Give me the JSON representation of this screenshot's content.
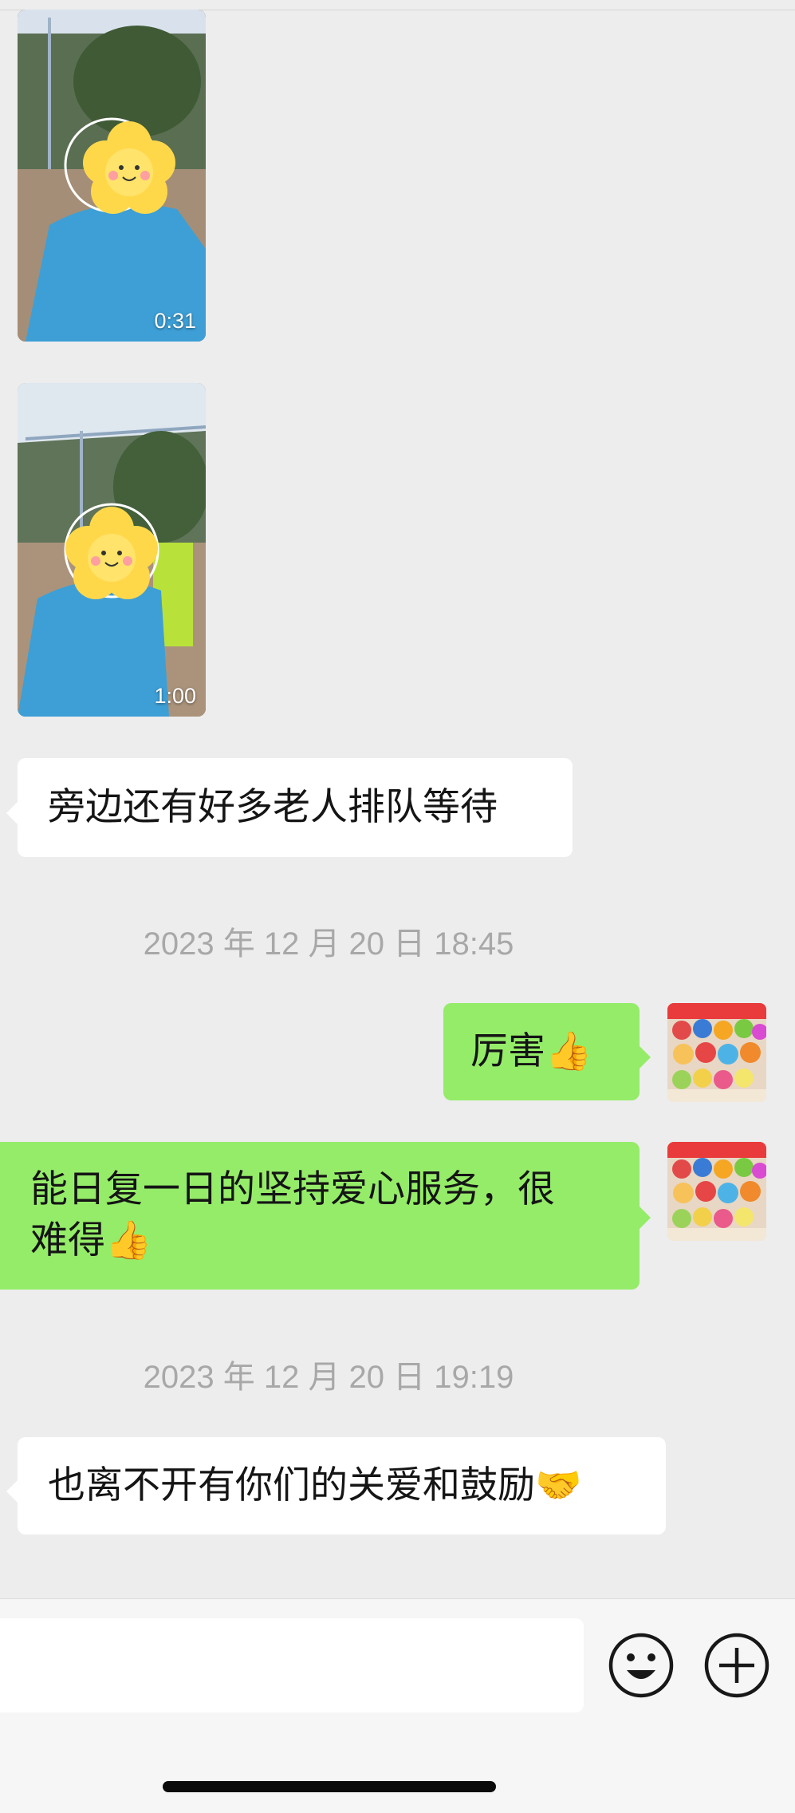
{
  "messages": {
    "video1": {
      "duration": "0:31"
    },
    "video2": {
      "duration": "1:00"
    },
    "incoming1": {
      "text": "旁边还有好多老人排队等待"
    },
    "timestamp1": {
      "text": "2023 年 12 月 20 日 18:45"
    },
    "outgoing1": {
      "text": "厉害",
      "emoji": "👍"
    },
    "outgoing2": {
      "line1": "能日复一日的坚持爱心服务，很",
      "line2": "难得",
      "emoji": "👍"
    },
    "timestamp2": {
      "text": "2023 年 12 月 20 日 19:19"
    },
    "incoming2": {
      "text": "也离不开有你们的关爱和鼓励",
      "emoji": "🤝"
    }
  },
  "input_bar": {
    "input_value": "",
    "emoji_icon": "smiley-face-icon",
    "more_icon": "plus-circle-icon"
  },
  "colors": {
    "background": "#ededed",
    "outgoing_bubble": "#95ec69",
    "incoming_bubble": "#ffffff",
    "timestamp_text": "#a8a8a8"
  }
}
